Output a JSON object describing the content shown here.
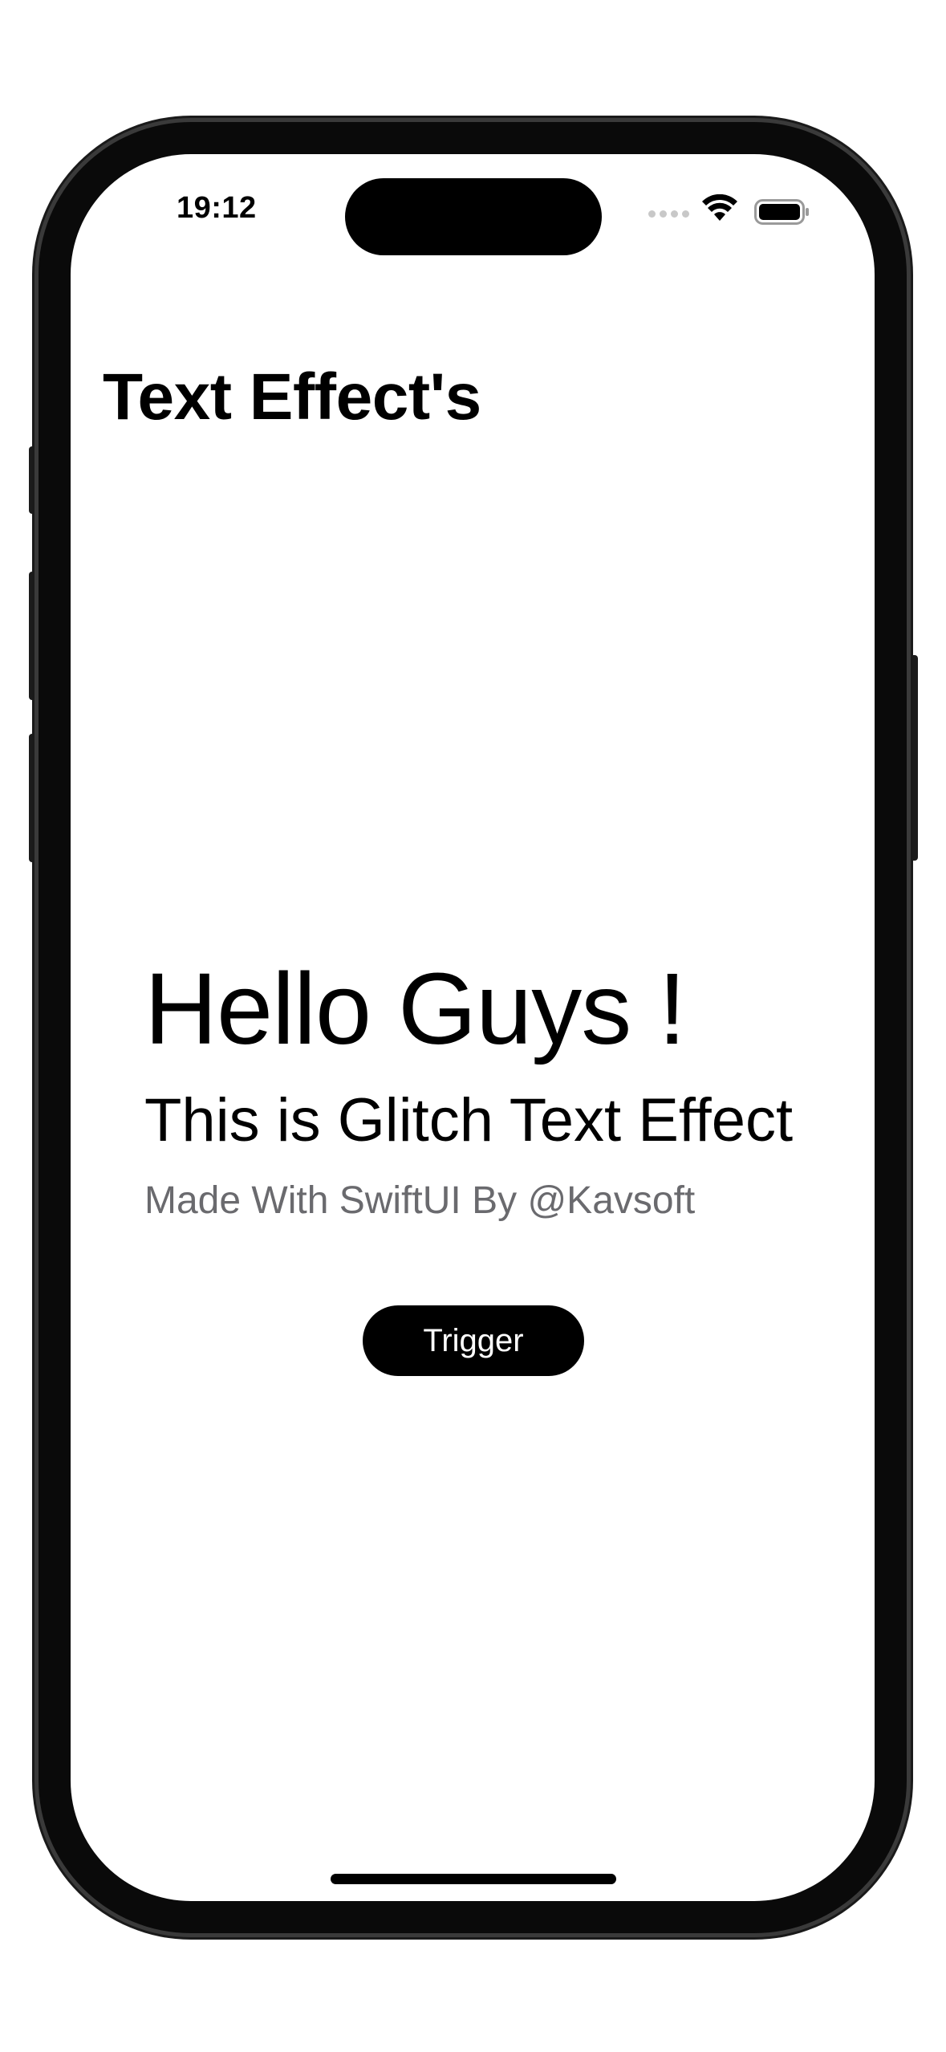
{
  "status_bar": {
    "time": "19:12",
    "signal_icon": "cellular-dots-icon",
    "wifi_icon": "wifi-icon",
    "battery_icon": "battery-icon"
  },
  "navigation": {
    "title": "Text Effect's"
  },
  "content": {
    "headline": "Hello Guys !",
    "subheadline": "This is Glitch Text Effect",
    "credit": "Made With SwiftUI By @Kavsoft"
  },
  "actions": {
    "trigger_label": "Trigger"
  },
  "colors": {
    "primary": "#000000",
    "secondary_text": "#6a6a6e",
    "background": "#ffffff",
    "button_text": "#ffffff"
  }
}
